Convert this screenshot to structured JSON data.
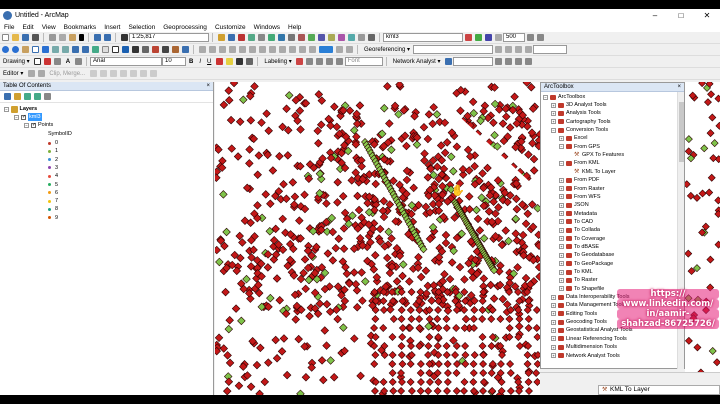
{
  "window": {
    "title": "Untitled - ArcMap",
    "controls": [
      "–",
      "□",
      "✕"
    ]
  },
  "menu": [
    "File",
    "Edit",
    "View",
    "Bookmarks",
    "Insert",
    "Selection",
    "Geoprocessing",
    "Customize",
    "Windows",
    "Help"
  ],
  "toolbar": {
    "scale": "1:25,817",
    "layer_select": "kml3",
    "georeferencing_label": "Georeferencing ▾",
    "zoom_value": "500",
    "drawing_label": "Drawing ▾",
    "font_name": "Arial",
    "font_size": "10",
    "bold": "B",
    "italic": "I",
    "underline": "U",
    "text_tool": "A",
    "labeling_label": "Labeling ▾",
    "font_field": "Font",
    "network_label": "Network Analyst ▾",
    "editor_label": "Editor ▾",
    "clip_merge": "Clip, Merge..."
  },
  "toc": {
    "title": "Table Of Contents",
    "close": "×",
    "layers_label": "Layers",
    "layer_name": "kml3",
    "sublayer": "Points",
    "field": "SymbolID",
    "classes": [
      {
        "label": "0",
        "color": "#c0392b"
      },
      {
        "label": "1",
        "color": "#7fb13c"
      },
      {
        "label": "2",
        "color": "#3a8fd6"
      },
      {
        "label": "3",
        "color": "#8e44ad"
      },
      {
        "label": "4",
        "color": "#e74c3c"
      },
      {
        "label": "5",
        "color": "#27ae60"
      },
      {
        "label": "6",
        "color": "#f39c12"
      },
      {
        "label": "7",
        "color": "#f1c40f"
      },
      {
        "label": "8",
        "color": "#16a085"
      },
      {
        "label": "9",
        "color": "#d35400"
      }
    ]
  },
  "toolbox": {
    "title": "ArcToolbox",
    "close": "×",
    "root": "ArcToolbox",
    "items": [
      {
        "label": "3D Analyst Tools",
        "level": 1,
        "type": "box",
        "exp": "+"
      },
      {
        "label": "Analysis Tools",
        "level": 1,
        "type": "box",
        "exp": "+"
      },
      {
        "label": "Cartography Tools",
        "level": 1,
        "type": "box",
        "exp": "+"
      },
      {
        "label": "Conversion Tools",
        "level": 1,
        "type": "box",
        "exp": "-"
      },
      {
        "label": "Excel",
        "level": 2,
        "type": "box",
        "exp": "+"
      },
      {
        "label": "From GPS",
        "level": 2,
        "type": "box",
        "exp": "-"
      },
      {
        "label": "GPX To Features",
        "level": 3,
        "type": "tool",
        "exp": ""
      },
      {
        "label": "From KML",
        "level": 2,
        "type": "box",
        "exp": "-"
      },
      {
        "label": "KML To Layer",
        "level": 3,
        "type": "tool",
        "exp": ""
      },
      {
        "label": "From PDF",
        "level": 2,
        "type": "box",
        "exp": "+"
      },
      {
        "label": "From Raster",
        "level": 2,
        "type": "box",
        "exp": "+"
      },
      {
        "label": "From WFS",
        "level": 2,
        "type": "box",
        "exp": "+"
      },
      {
        "label": "JSON",
        "level": 2,
        "type": "box",
        "exp": "+"
      },
      {
        "label": "Metadata",
        "level": 2,
        "type": "box",
        "exp": "+"
      },
      {
        "label": "To CAD",
        "level": 2,
        "type": "box",
        "exp": "+"
      },
      {
        "label": "To Collada",
        "level": 2,
        "type": "box",
        "exp": "+"
      },
      {
        "label": "To Coverage",
        "level": 2,
        "type": "box",
        "exp": "+"
      },
      {
        "label": "To dBASE",
        "level": 2,
        "type": "box",
        "exp": "+"
      },
      {
        "label": "To Geodatabase",
        "level": 2,
        "type": "box",
        "exp": "+"
      },
      {
        "label": "To GeoPackage",
        "level": 2,
        "type": "box",
        "exp": "+"
      },
      {
        "label": "To KML",
        "level": 2,
        "type": "box",
        "exp": "+"
      },
      {
        "label": "To Raster",
        "level": 2,
        "type": "box",
        "exp": "+"
      },
      {
        "label": "To Shapefile",
        "level": 2,
        "type": "box",
        "exp": "+"
      },
      {
        "label": "Data Interoperability Tools",
        "level": 1,
        "type": "box",
        "exp": "+"
      },
      {
        "label": "Data Management Tools",
        "level": 1,
        "type": "box",
        "exp": "+"
      },
      {
        "label": "Editing Tools",
        "level": 1,
        "type": "box",
        "exp": "+"
      },
      {
        "label": "Geocoding Tools",
        "level": 1,
        "type": "box",
        "exp": "+"
      },
      {
        "label": "Geostatistical Analyst Tools",
        "level": 1,
        "type": "box",
        "exp": "+"
      },
      {
        "label": "Linear Referencing Tools",
        "level": 1,
        "type": "box",
        "exp": "+"
      },
      {
        "label": "Multidimension Tools",
        "level": 1,
        "type": "box",
        "exp": "+"
      },
      {
        "label": "Network Analyst Tools",
        "level": 1,
        "type": "box",
        "exp": "+"
      }
    ]
  },
  "overlay": {
    "lines": [
      "https://",
      "www.linkedin.com/",
      "in/aamir-",
      "shahzad-86725726/"
    ]
  },
  "status": {
    "running_tool": "KML To Layer"
  }
}
